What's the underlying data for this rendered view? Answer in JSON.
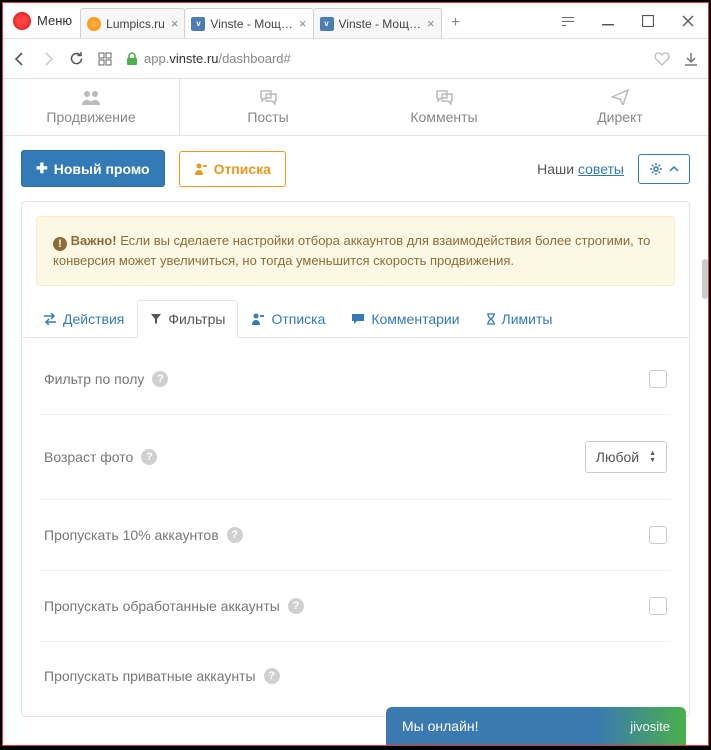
{
  "browser": {
    "menu": "Меню",
    "tabs": [
      {
        "label": "Lumpics.ru",
        "icon": "orange"
      },
      {
        "label": "Vinste - Мощ…",
        "icon": "blue"
      },
      {
        "label": "Vinste - Мощ…",
        "icon": "blue"
      }
    ],
    "url_prefix": "app.",
    "url_domain": "vinste.ru",
    "url_path": "/dashboard#"
  },
  "topnav": [
    {
      "label": "Продвижение"
    },
    {
      "label": "Посты"
    },
    {
      "label": "Комменты"
    },
    {
      "label": "Директ"
    }
  ],
  "toolbar": {
    "new_promo": "Новый промо",
    "unsub": "Отписка",
    "tips_prefix": "Наши ",
    "tips_link": "советы"
  },
  "alert": {
    "strong": "Важно!",
    "text": " Если вы сделаете настройки отбора аккаунтов для взаимодействия более строгими, то конверсия может увеличиться, но тогда уменьшится скорость продвижения."
  },
  "subtabs": [
    {
      "label": "Действия"
    },
    {
      "label": "Фильтры"
    },
    {
      "label": "Отписка"
    },
    {
      "label": "Комментарии"
    },
    {
      "label": "Лимиты"
    }
  ],
  "filters": {
    "gender": "Фильтр по полу",
    "photo_age": "Возраст фото",
    "photo_age_value": "Любой",
    "skip_pct": "Пропускать 10% аккаунтов",
    "skip_processed": "Пропускать обработанные аккаунты",
    "skip_private": "Пропускать приватные аккаунты"
  },
  "jivo": {
    "status": "Мы онлайн!",
    "brand": "jivosite"
  }
}
